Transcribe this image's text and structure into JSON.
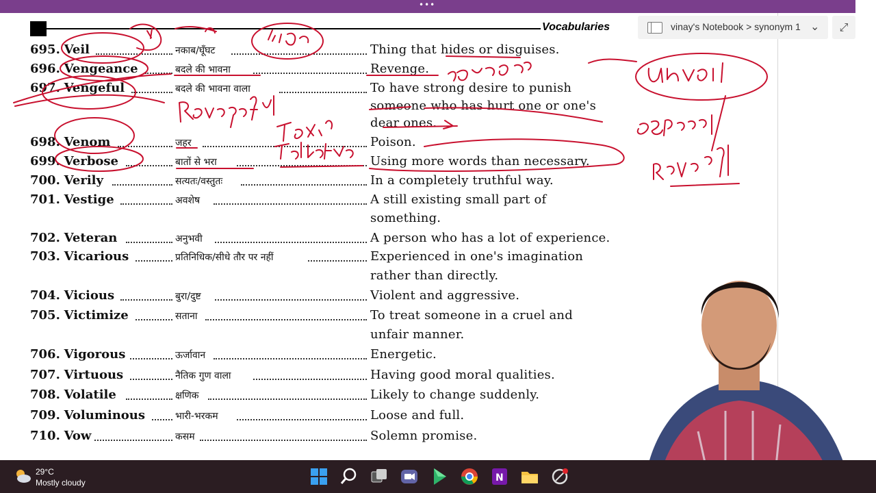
{
  "window": {
    "title_dots": "•••"
  },
  "header": {
    "title": "Vocabularies"
  },
  "onenote": {
    "notebook_path": "vinay's Notebook > synonym 1",
    "expand_icon": "expand-icon"
  },
  "entries": [
    {
      "num": "695.",
      "word": "Veil",
      "hindi": "नकाब/घूँघट",
      "meaning1": "Thing that hides or disguises.",
      "meaning2": ""
    },
    {
      "num": "696.",
      "word": "Vengeance",
      "hindi": "बदले की भावना",
      "meaning1": "Revenge.",
      "meaning2": ""
    },
    {
      "num": "697.",
      "word": "Vengeful",
      "hindi": "बदले की भावना वाला",
      "meaning1": "To have strong desire to punish",
      "meaning2": "someone who has hurt one or one's",
      "meaning3": "dear ones."
    },
    {
      "num": "698.",
      "word": "Venom",
      "hindi": "जहर",
      "meaning1": "Poison.",
      "meaning2": ""
    },
    {
      "num": "699.",
      "word": "Verbose",
      "hindi": "बातों से भरा",
      "meaning1": "Using more words than necessary.",
      "meaning2": ""
    },
    {
      "num": "700.",
      "word": "Verily",
      "hindi": "सत्यतः/वस्तुतः",
      "meaning1": "In a completely truthful way.",
      "meaning2": ""
    },
    {
      "num": "701.",
      "word": "Vestige",
      "hindi": "अवशेष",
      "meaning1": "A still existing small part of",
      "meaning2": "something."
    },
    {
      "num": "702.",
      "word": "Veteran",
      "hindi": "अनुभवी",
      "meaning1": "A person who has a lot of experience.",
      "meaning2": ""
    },
    {
      "num": "703.",
      "word": "Vicarious",
      "hindi": "प्रतिनिधिक/सीधे तौर पर नहीं",
      "meaning1": "Experienced in one's imagination",
      "meaning2": "rather than directly."
    },
    {
      "num": "704.",
      "word": "Vicious",
      "hindi": "बुरा/दुष्ट",
      "meaning1": "Violent and aggressive.",
      "meaning2": ""
    },
    {
      "num": "705.",
      "word": "Victimize",
      "hindi": "सताना",
      "meaning1": "To treat someone in a cruel and",
      "meaning2": "unfair manner."
    },
    {
      "num": "706.",
      "word": "Vigorous",
      "hindi": "ऊर्जावान",
      "meaning1": "Energetic.",
      "meaning2": ""
    },
    {
      "num": "707.",
      "word": "Virtuous",
      "hindi": "नैतिक गुण वाला",
      "meaning1": "Having good moral qualities.",
      "meaning2": ""
    },
    {
      "num": "708.",
      "word": "Volatile",
      "hindi": "क्षणिक",
      "meaning1": "Likely to change suddenly.",
      "meaning2": ""
    },
    {
      "num": "709.",
      "word": "Voluminous",
      "hindi": "भारी-भरकम",
      "meaning1": "Loose and full.",
      "meaning2": ""
    },
    {
      "num": "710.",
      "word": "Vow",
      "hindi": "कसम",
      "meaning1": "Solemn promise.",
      "meaning2": ""
    }
  ],
  "taskbar": {
    "temperature": "29°C",
    "condition": "Mostly cloudy",
    "apps": [
      "windows-start",
      "search",
      "task-view",
      "teams",
      "sheets",
      "chrome",
      "onenote",
      "file-explorer",
      "screen-recorder"
    ]
  },
  "colors": {
    "titlebar": "#7a3e8c",
    "ink": "#c8102e",
    "taskbar": "#2b1d22"
  }
}
